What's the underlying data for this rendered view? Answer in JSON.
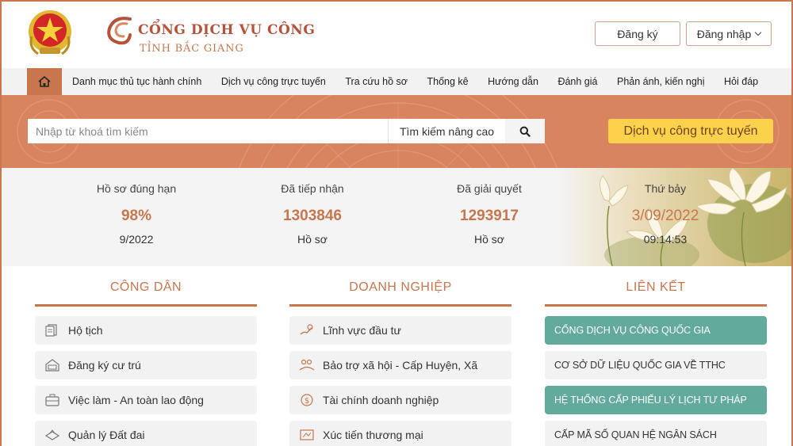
{
  "header": {
    "brand_title": "CỔNG DỊCH VỤ CÔNG",
    "brand_subtitle": "TỈNH BẮC GIANG",
    "register_label": "Đăng ký",
    "login_label": "Đăng nhập"
  },
  "nav": {
    "items": [
      "Danh mục thủ tục hành chính",
      "Dịch vụ công trực tuyến",
      "Tra cứu hồ sơ",
      "Thống kê",
      "Hướng dẫn",
      "Đánh giá",
      "Phản ánh, kiến nghị",
      "Hỏi đáp"
    ]
  },
  "search": {
    "placeholder": "Nhập từ khoá tìm kiếm",
    "advanced_label": "Tìm kiếm nâng cao",
    "online_service_label": "Dịch vụ công trực tuyến"
  },
  "stats": [
    {
      "label": "Hồ sơ đúng hạn",
      "value": "98%",
      "unit": "9/2022"
    },
    {
      "label": "Đã tiếp nhận",
      "value": "1303846",
      "unit": "Hồ sơ"
    },
    {
      "label": "Đã giải quyết",
      "value": "1293917",
      "unit": "Hồ sơ"
    },
    {
      "label": "Thứ bảy",
      "value": "3/09/2022",
      "unit": "09:14:53"
    }
  ],
  "columns": {
    "citizen": {
      "title": "CÔNG DÂN",
      "items": [
        "Hộ tịch",
        "Đăng ký cư trú",
        "Việc làm - An toàn lao động",
        "Quản lý Đất đai"
      ]
    },
    "business": {
      "title": "DOANH NGHIỆP",
      "items": [
        "Lĩnh vực đầu tư",
        "Bảo trợ xã hội - Cấp Huyện, Xã",
        "Tài chính doanh nghiệp",
        "Xúc tiến thương mại"
      ]
    },
    "links": {
      "title": "LIÊN KẾT",
      "items": [
        "CỔNG DỊCH VỤ CÔNG QUỐC GIA",
        "CƠ SỞ DỮ LIỆU QUỐC GIA VỀ TTHC",
        "HỆ THỐNG CẤP PHIẾU LÝ LỊCH TƯ PHÁP",
        "CẤP MÃ SỐ QUAN HỆ NGÂN SÁCH"
      ]
    }
  },
  "colors": {
    "accent": "#c8764e",
    "highlight": "#fbd24b",
    "link_teal": "#62aa9c"
  }
}
